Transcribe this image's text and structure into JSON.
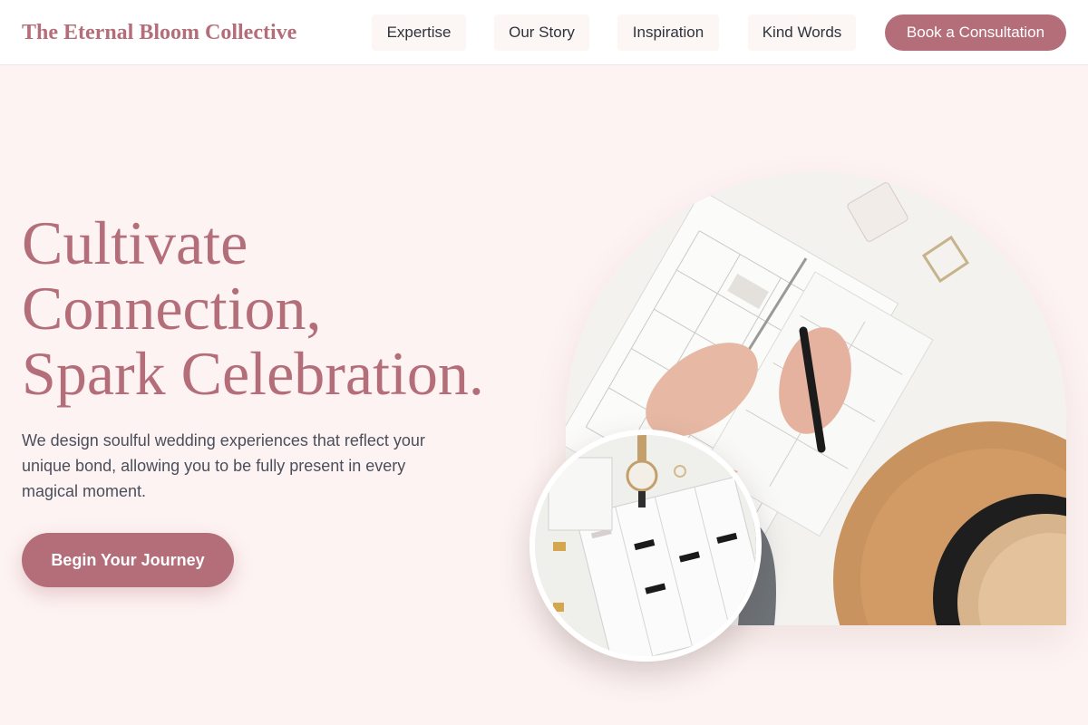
{
  "brand": {
    "name": "The Eternal Bloom Collective"
  },
  "nav": {
    "items": [
      {
        "label": "Expertise"
      },
      {
        "label": "Our Story"
      },
      {
        "label": "Inspiration"
      },
      {
        "label": "Kind Words"
      }
    ],
    "cta_label": "Book a Consultation"
  },
  "hero": {
    "headline_lines": [
      "Cultivate",
      "Connection,",
      "Spark Celebration."
    ],
    "subtext": "We design soulful wedding experiences that reflect your unique bond, allowing you to be fully present in every magical moment.",
    "button_label": "Begin Your Journey"
  },
  "colors": {
    "accent": "#b46e79",
    "background": "#fdf3f2",
    "header_bg": "#ffffff",
    "nav_pill_bg": "#fcf6f5",
    "body_text": "#4b4f5c"
  },
  "images": {
    "main_photo": "planner-hands-hat-photo",
    "circle_photo": "planner-watch-photo"
  }
}
